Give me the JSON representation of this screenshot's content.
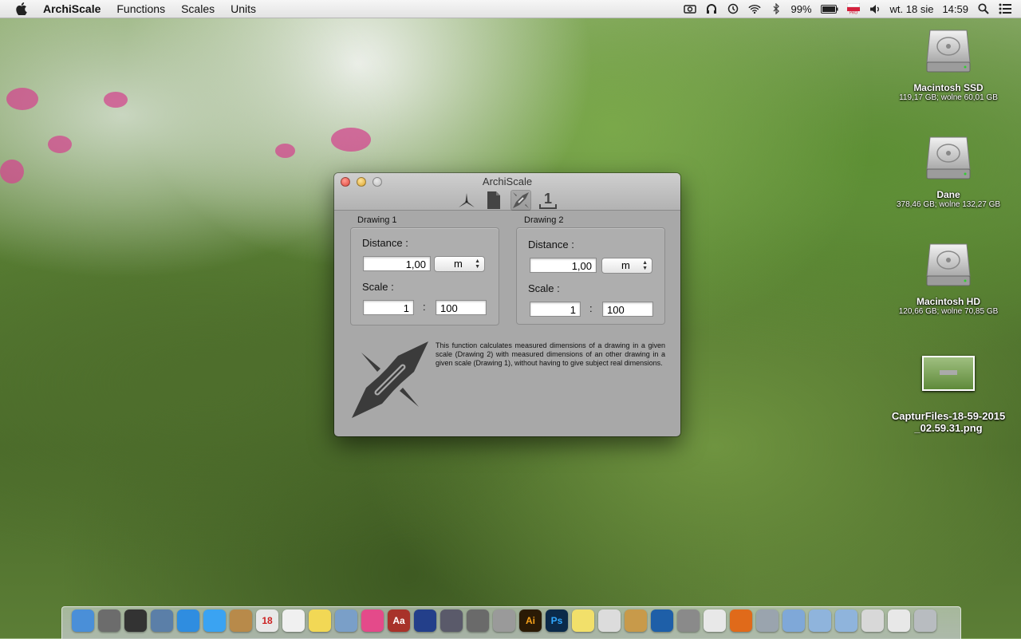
{
  "menubar": {
    "app_name": "ArchiScale",
    "menus": [
      "Functions",
      "Scales",
      "Units"
    ],
    "battery": "99%",
    "date": "wt. 18 sie",
    "time": "14:59",
    "status_icons": [
      "camera-icon",
      "headphones-icon",
      "time-machine-icon",
      "wifi-icon",
      "bluetooth-icon",
      "battery-icon",
      "flag-pl-icon",
      "volume-icon",
      "spotlight-icon",
      "notification-center-icon"
    ]
  },
  "desktop": {
    "icons": [
      {
        "name": "Macintosh SSD",
        "info": "119,17 GB; wolne 60,01 GB"
      },
      {
        "name": "Dane",
        "info": "378,46 GB; wolne 132,27 GB"
      },
      {
        "name": "Macintosh HD",
        "info": "120,66 GB; wolne 70,85 GB"
      }
    ],
    "file": {
      "name_line1": "CapturFiles-18-59-2015",
      "name_line2": "_02.59.31.png"
    }
  },
  "window": {
    "title": "ArchiScale",
    "toolbar": [
      "compass-icon",
      "document-icon",
      "scale-compare-icon",
      "unit-one-icon"
    ],
    "drawing1": {
      "label": "Drawing 1",
      "distance_label": "Distance :",
      "distance_value": "1,00",
      "unit": "m",
      "scale_label": "Scale :",
      "scale_left": "1",
      "scale_sep": ":",
      "scale_right": "100"
    },
    "drawing2": {
      "label": "Drawing 2",
      "distance_label": "Distance :",
      "distance_value": "1,00",
      "unit": "m",
      "scale_label": "Scale :",
      "scale_left": "1",
      "scale_sep": ":",
      "scale_right": "100"
    },
    "description": "This function calculates measured dimensions of a drawing in a given scale (Drawing 2) with measured dimensions of an other drawing in a given scale (Drawing 1), without having to give subject real dimensions."
  },
  "dock": {
    "apps": [
      {
        "icon": "finder-icon",
        "label": "",
        "color": "#4a8fd8"
      },
      {
        "icon": "launchpad-icon",
        "label": "",
        "color": "#6c6c6c"
      },
      {
        "icon": "dashboard-icon",
        "label": "",
        "color": "#333333"
      },
      {
        "icon": "preview-icon",
        "label": "",
        "color": "#5b7fa8"
      },
      {
        "icon": "safari-icon",
        "label": "",
        "color": "#2f8de0"
      },
      {
        "icon": "messages-icon",
        "label": "",
        "color": "#3aa3f2"
      },
      {
        "icon": "contacts-icon",
        "label": "",
        "color": "#b88a4a"
      },
      {
        "icon": "calendar-icon",
        "label": "18",
        "color": "#e8e8e8"
      },
      {
        "icon": "reminders-icon",
        "label": "",
        "color": "#f0f0f0"
      },
      {
        "icon": "notes-icon",
        "label": "",
        "color": "#f2d855"
      },
      {
        "icon": "photos-icon",
        "label": "",
        "color": "#7a9fc8"
      },
      {
        "icon": "itunes-icon",
        "label": "",
        "color": "#e44a8a"
      },
      {
        "icon": "dictionary-icon",
        "label": "Aa",
        "color": "#a8322a"
      },
      {
        "icon": "flag-uk-icon",
        "label": "",
        "color": "#233f8a"
      },
      {
        "icon": "scripteditor-icon",
        "label": "",
        "color": "#5a5a6a"
      },
      {
        "icon": "archiscale-icon",
        "label": "",
        "color": "#6a6a6a"
      },
      {
        "icon": "calculator-icon",
        "label": "",
        "color": "#9a9a9a"
      },
      {
        "icon": "illustrator-icon",
        "label": "Ai",
        "color": "#2a1a05"
      },
      {
        "icon": "photoshop-icon",
        "label": "Ps",
        "color": "#0b2a4a"
      },
      {
        "icon": "stickies-icon",
        "label": "",
        "color": "#f2e06a"
      },
      {
        "icon": "textedit-icon",
        "label": "",
        "color": "#dcdcdc"
      },
      {
        "icon": "search-icon",
        "label": "",
        "color": "#c89a4a"
      },
      {
        "icon": "network-icon",
        "label": "",
        "color": "#1e5fa8"
      },
      {
        "icon": "system-prefs-icon",
        "label": "",
        "color": "#8a8a8a"
      },
      {
        "icon": "vuze-icon",
        "label": "",
        "color": "#e8e8e8"
      },
      {
        "icon": "firefox-icon",
        "label": "",
        "color": "#e06a1a"
      },
      {
        "icon": "compass-app-icon",
        "label": "",
        "color": "#9aa4ae"
      },
      {
        "icon": "applications-folder-icon",
        "label": "",
        "color": "#7fa8d8"
      },
      {
        "icon": "documents-folder-icon",
        "label": "",
        "color": "#8fb4dc"
      },
      {
        "icon": "downloads-folder-icon",
        "label": "",
        "color": "#8fb4dc"
      },
      {
        "icon": "screenshot-stack-icon",
        "label": "",
        "color": "#d8d8d8"
      },
      {
        "icon": "document-stack-icon",
        "label": "",
        "color": "#e8e8e8"
      },
      {
        "icon": "trash-icon",
        "label": "",
        "color": "#b8bcc0"
      }
    ]
  }
}
